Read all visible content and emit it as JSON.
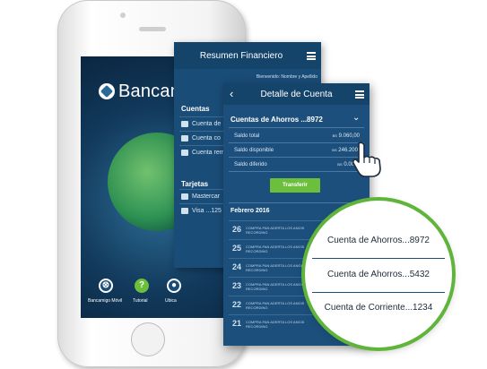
{
  "home": {
    "logo_text": "Bancam",
    "bottom_items": [
      {
        "label": "Bancamigo Móvil",
        "icon": "bank-icon",
        "color": "#ffffff"
      },
      {
        "label": "Tutorial",
        "icon": "help-icon",
        "color": "#6cbf3c"
      },
      {
        "label": "Ubica",
        "icon": "location-icon",
        "color": "#ffffff"
      }
    ]
  },
  "resumen": {
    "title": "Resumen Financiero",
    "greeting": "Bienvenido: Nombre y Apellido",
    "cuentas_header": "Cuentas",
    "cuentas": [
      "Cuenta de",
      "Cuenta co",
      "Cuenta rem"
    ],
    "tarjetas_header": "Tarjetas",
    "tarjetas": [
      "Mastercar",
      "Visa ...125"
    ]
  },
  "detalle": {
    "title": "Detalle de Cuenta",
    "account": "Cuentas de Ahorros ...8972",
    "rows": [
      {
        "label": "Saldo total",
        "value": "9.060,00",
        "prefix": "BS"
      },
      {
        "label": "Saldo disponible",
        "value": "246.200",
        "prefix": "BS"
      },
      {
        "label": "Saldo diferido",
        "value": "0.00",
        "prefix": "BS"
      }
    ],
    "transfer_label": "Transferir",
    "month": "Febrero 2016",
    "transactions": [
      {
        "day": "26",
        "text": "COMPRA PAN ADERTA LOS ANGIS",
        "sub": "RECORDING"
      },
      {
        "day": "25",
        "text": "COMPRA PAN ADERTA LOS ANGIS",
        "sub": "RECORDING"
      },
      {
        "day": "24",
        "text": "COMPRA PAN ADERTA LOS ANGIS",
        "sub": "RECORDING"
      },
      {
        "day": "23",
        "text": "COMPRA PAN ADERTA LOS ANGIS",
        "sub": "RECORDING"
      },
      {
        "day": "22",
        "text": "COMPRA PAN ADERTA LOS ANGIS",
        "sub": "RECORDING"
      },
      {
        "day": "21",
        "text": "COMPRA PAN ADERTA LOS ANGIS",
        "sub": "RECORDING"
      }
    ]
  },
  "popup": {
    "items": [
      "Cuenta de Ahorros...8972",
      "Cuenta de Ahorros...5432",
      "Cuenta de Corriente...1234"
    ],
    "ring_color": "#5fb53a"
  }
}
